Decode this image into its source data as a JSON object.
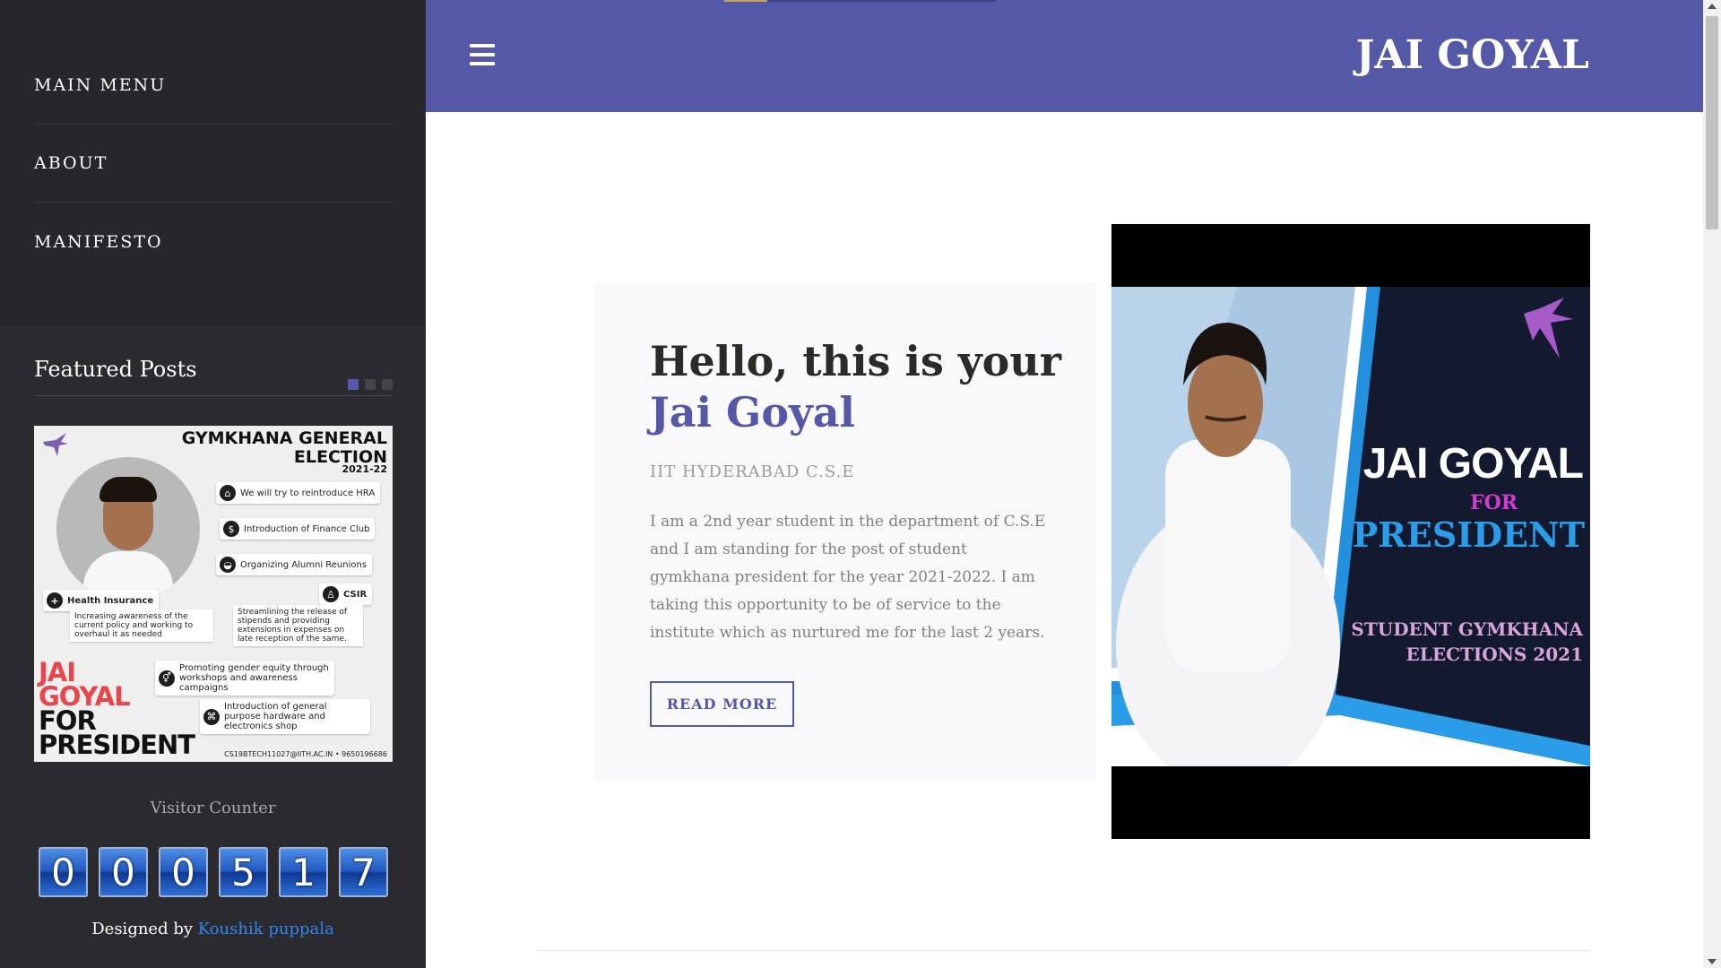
{
  "sidebar": {
    "menu": [
      {
        "label": "MAIN MENU"
      },
      {
        "label": "ABOUT"
      },
      {
        "label": "MANIFESTO"
      }
    ],
    "featured": {
      "title": "Featured Posts",
      "active_slide": 1,
      "slide_count": 3,
      "poster": {
        "heading_line1": "GYMKHANA GENERAL",
        "heading_line2": "ELECTION",
        "year": "2021-22",
        "points": [
          "We will try to reintroduce HRA",
          "Introduction of Finance Club",
          "Organizing Alumni Reunions",
          "CSIR",
          "Health Insurance",
          "Increasing awareness of the current policy and working to overhaul it as needed",
          "Streamlining the release of stipends and providing extensions in expenses on late reception of the same.",
          "Promoting gender equity through workshops and awareness campaigns",
          "Introduction of general purpose hardware and electronics shop"
        ],
        "slogan_line1": "JAI",
        "slogan_line2": "GOYAL",
        "slogan_line3": "FOR",
        "slogan_line4": "PRESIDENT",
        "footer": "CS19BTECH11027@IITH.AC.IN  •  9650196686"
      }
    },
    "visitor_counter": {
      "label": "Visitor Counter",
      "digits": [
        "0",
        "0",
        "0",
        "5",
        "1",
        "7"
      ]
    },
    "credit": {
      "prefix": "Designed by ",
      "author": "Koushik puppala"
    }
  },
  "header": {
    "site_title": "JAI GOYAL",
    "progress_fraction": 0.16
  },
  "hero": {
    "title_line1": "Hello, this is your",
    "title_line2": "Jai Goyal",
    "subtitle": "IIT HYDERABAD C.S.E",
    "description": "I am a 2nd year student in the department of C.S.E and I am standing for the post of student gymkhana president for the year 2021-2022. I am taking this opportunity to be of service to the institute which as nurtured me for the last 2 years.",
    "button_label": "READ MORE"
  },
  "campaign_poster": {
    "name": "JAI GOYAL",
    "for": "FOR",
    "position": "PRESIDENT",
    "subtitle_line1": "STUDENT GYMKHANA",
    "subtitle_line2": "ELECTIONS 2021"
  },
  "colors": {
    "accent": "#5458a6",
    "sidebar_bg": "#2a2a2f",
    "link": "#2f86f0",
    "poster_red": "#e8464c",
    "poster_blue": "#2a9ce8",
    "poster_magenta": "#d23bd1"
  },
  "icons": {
    "menu": "hamburger-menu-icon",
    "hummingbird": "hummingbird-logo-icon"
  }
}
